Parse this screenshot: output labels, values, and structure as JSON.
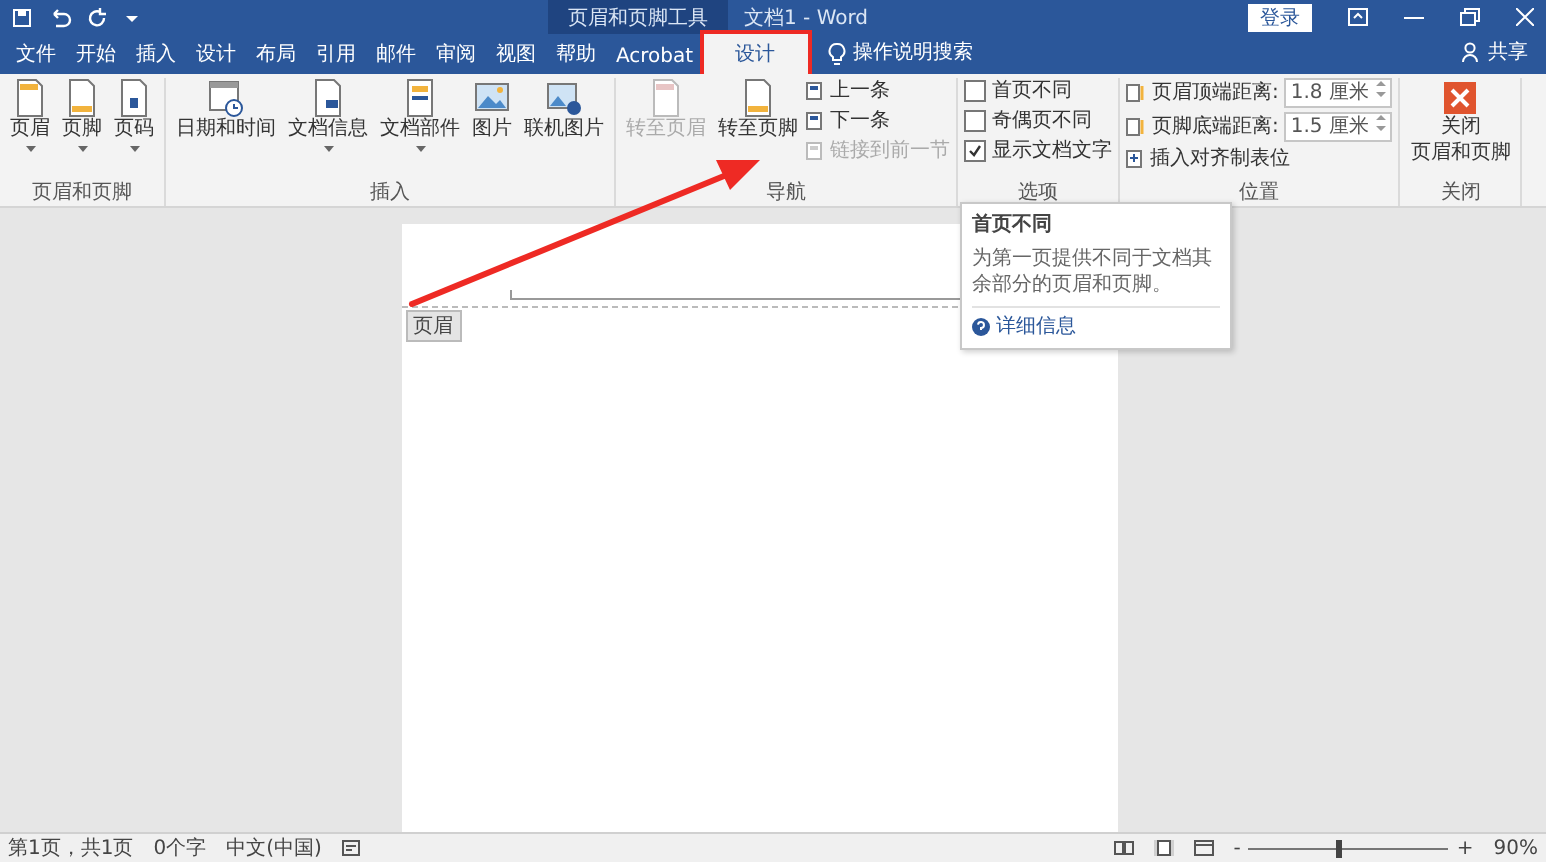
{
  "title_bar": {
    "context": "页眉和页脚工具",
    "title": "文档1 - Word",
    "sign_in": "登录"
  },
  "tabs": [
    {
      "label": "文件",
      "selected": false,
      "annotated": false
    },
    {
      "label": "开始",
      "selected": false,
      "annotated": false
    },
    {
      "label": "插入",
      "selected": false,
      "annotated": false
    },
    {
      "label": "设计",
      "selected": false,
      "annotated": false
    },
    {
      "label": "布局",
      "selected": false,
      "annotated": false
    },
    {
      "label": "引用",
      "selected": false,
      "annotated": false
    },
    {
      "label": "邮件",
      "selected": false,
      "annotated": false
    },
    {
      "label": "审阅",
      "selected": false,
      "annotated": false
    },
    {
      "label": "视图",
      "selected": false,
      "annotated": false
    },
    {
      "label": "帮助",
      "selected": false,
      "annotated": false
    },
    {
      "label": "Acrobat",
      "selected": false,
      "annotated": false
    },
    {
      "label": "设计",
      "selected": true,
      "annotated": true
    }
  ],
  "tell_me": "操作说明搜索",
  "share": "共享",
  "groups": [
    {
      "name": "页眉和页脚",
      "buttons": [
        {
          "label": "页眉",
          "kind": "header",
          "dropdown": true,
          "disabled": false
        },
        {
          "label": "页脚",
          "kind": "footer",
          "dropdown": true,
          "disabled": false
        },
        {
          "label": "页码",
          "kind": "page-number",
          "dropdown": true,
          "disabled": false
        }
      ]
    },
    {
      "name": "插入",
      "buttons": [
        {
          "label": "日期和时间",
          "kind": "calendar",
          "dropdown": false,
          "disabled": false
        },
        {
          "label": "文档信息",
          "kind": "doc-info",
          "dropdown": true,
          "disabled": false
        },
        {
          "label": "文档部件",
          "kind": "doc-parts",
          "dropdown": true,
          "disabled": false
        },
        {
          "label": "图片",
          "kind": "picture",
          "dropdown": false,
          "disabled": false
        },
        {
          "label": "联机图片",
          "kind": "online-picture",
          "dropdown": false,
          "disabled": false
        }
      ]
    },
    {
      "name": "导航",
      "buttons": [
        {
          "label": "转至页眉",
          "kind": "goto-header",
          "dropdown": false,
          "disabled": true
        },
        {
          "label": "转至页脚",
          "kind": "goto-footer",
          "dropdown": false,
          "disabled": false
        }
      ],
      "small": [
        {
          "label": "上一条",
          "disabled": false
        },
        {
          "label": "下一条",
          "disabled": false
        },
        {
          "label": "链接到前一节",
          "disabled": true
        }
      ]
    }
  ],
  "options": {
    "name": "选项",
    "items": [
      {
        "label": "首页不同",
        "checked": false
      },
      {
        "label": "奇偶页不同",
        "checked": false
      },
      {
        "label": "显示文档文字",
        "checked": true
      }
    ]
  },
  "position": {
    "name": "位置",
    "fields": [
      {
        "label": "页眉顶端距离:",
        "value": "1.8 厘米"
      },
      {
        "label": "页脚底端距离:",
        "value": "1.5 厘米"
      }
    ],
    "tab_button": "插入对齐制表位"
  },
  "close": {
    "name": "关闭",
    "lines": [
      "关闭",
      "页眉和页脚"
    ]
  },
  "tooltip": {
    "title": "首页不同",
    "body": "为第一页提供不同于文档其余部分的页眉和页脚。",
    "link": "详细信息"
  },
  "page": {
    "header_tag": "页眉"
  },
  "status_bar": {
    "items": [
      "第1页，共1页",
      "0个字",
      "中文(中国)"
    ],
    "zoom": {
      "out": "-",
      "level": 0.45,
      "in": "+",
      "reading": "90%"
    }
  }
}
